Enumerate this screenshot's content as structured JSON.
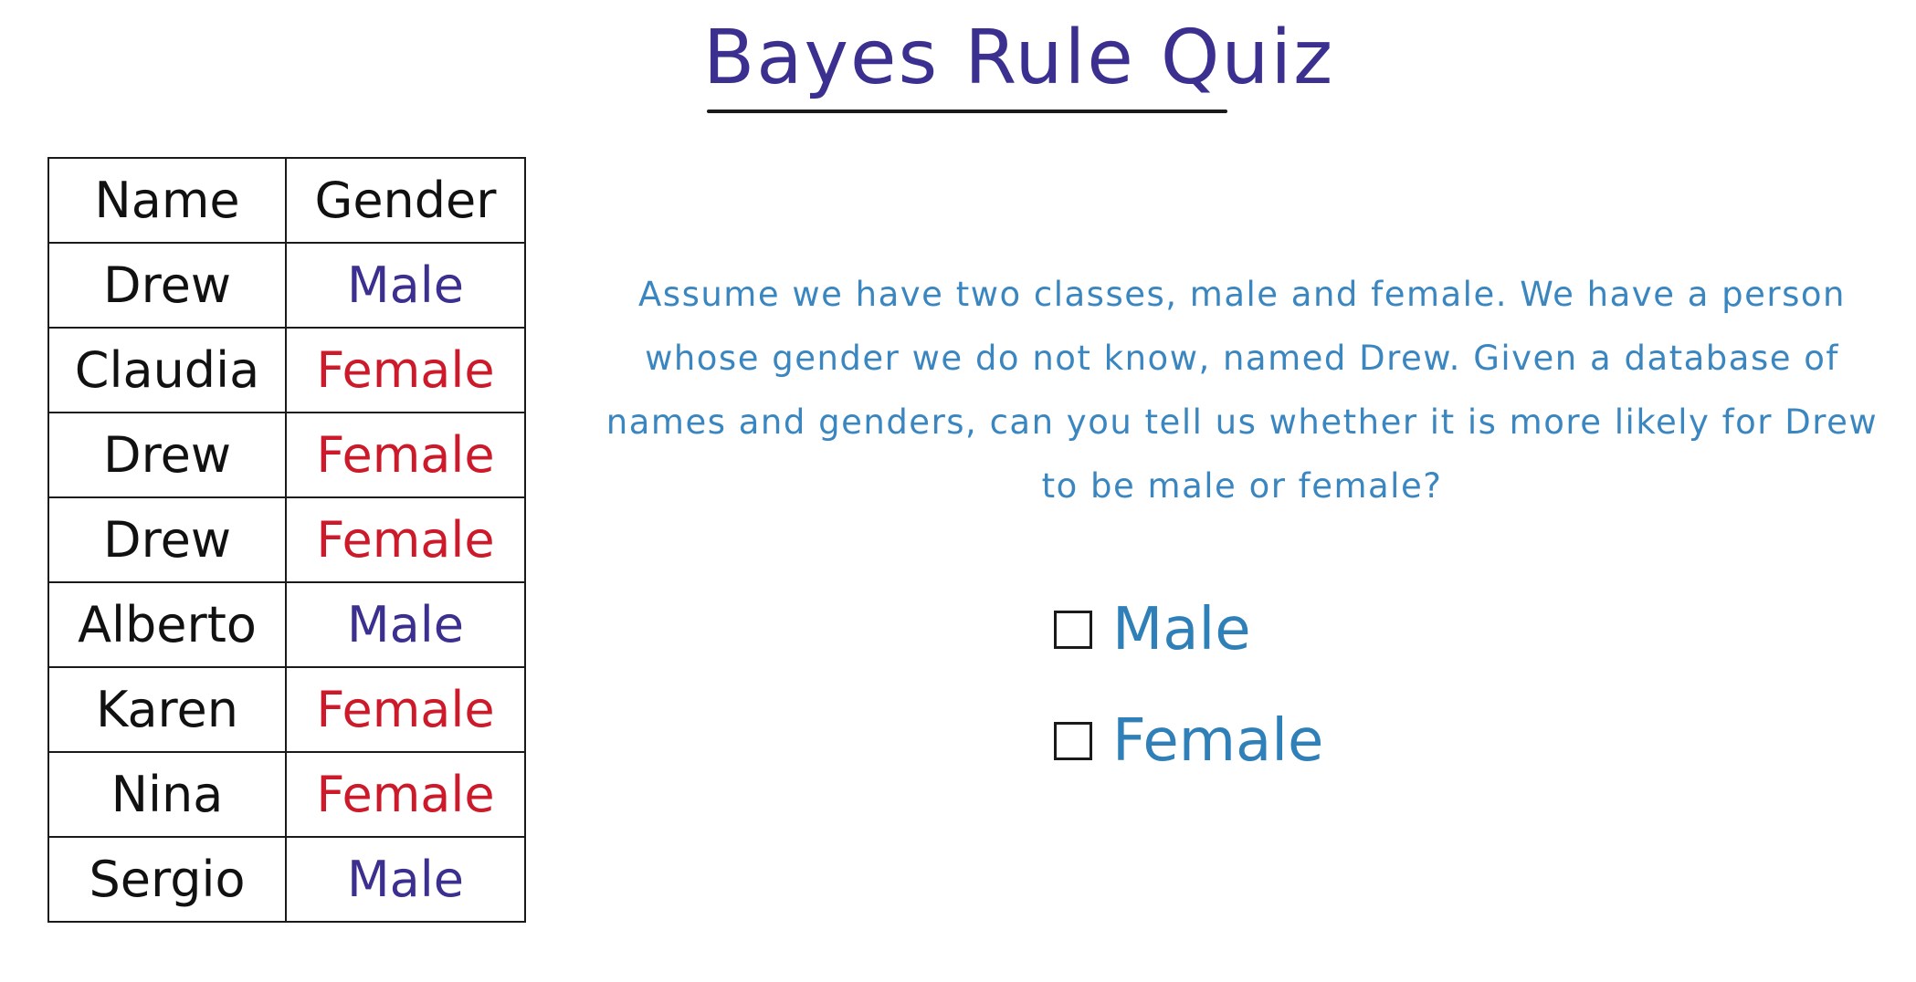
{
  "title": "Bayes Rule Quiz",
  "table": {
    "headers": [
      "Name",
      "Gender"
    ],
    "rows": [
      {
        "name": "Drew",
        "gender": "Male"
      },
      {
        "name": "Claudia",
        "gender": "Female"
      },
      {
        "name": "Drew",
        "gender": "Female"
      },
      {
        "name": "Drew",
        "gender": "Female"
      },
      {
        "name": "Alberto",
        "gender": "Male"
      },
      {
        "name": "Karen",
        "gender": "Female"
      },
      {
        "name": "Nina",
        "gender": "Female"
      },
      {
        "name": "Sergio",
        "gender": "Male"
      }
    ]
  },
  "question": "Assume we have two classes, male and female. We have a person whose gender we do not know, named Drew. Given a database of names and genders, can you tell us whether it is more likely for Drew to be male or female?",
  "options": [
    {
      "label": "Male",
      "checked": false
    },
    {
      "label": "Female",
      "checked": false
    }
  ],
  "colors": {
    "title": "#3b2f8f",
    "male": "#3b2f8f",
    "female": "#cc1a2a",
    "question": "#3a86c0",
    "option": "#2f7fb8"
  }
}
